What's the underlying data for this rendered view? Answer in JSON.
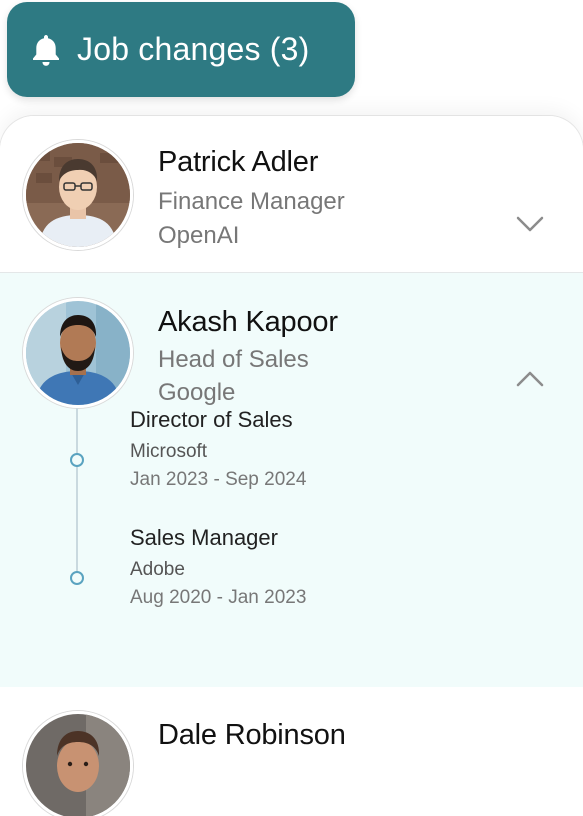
{
  "header": {
    "badge_label": "Job changes (3)",
    "badge_color": "#2e7a83",
    "icon": "bell-icon"
  },
  "contacts": [
    {
      "name": "Patrick Adler",
      "title": "Finance Manager",
      "company": "OpenAI",
      "expanded": false,
      "toggle_icon": "chevron-down-icon"
    },
    {
      "name": "Akash Kapoor",
      "title": "Head of Sales",
      "company": "Google",
      "expanded": true,
      "toggle_icon": "chevron-up-icon",
      "history": [
        {
          "title": "Director of Sales",
          "company": "Microsoft",
          "dates": "Jan 2023 - Sep 2024"
        },
        {
          "title": "Sales Manager",
          "company": "Adobe",
          "dates": "Aug 2020 - Jan 2023"
        }
      ]
    },
    {
      "name": "Dale Robinson"
    }
  ],
  "colors": {
    "expanded_row_bg": "#f1fcfb",
    "timeline_dot": "#5aa3c0"
  }
}
